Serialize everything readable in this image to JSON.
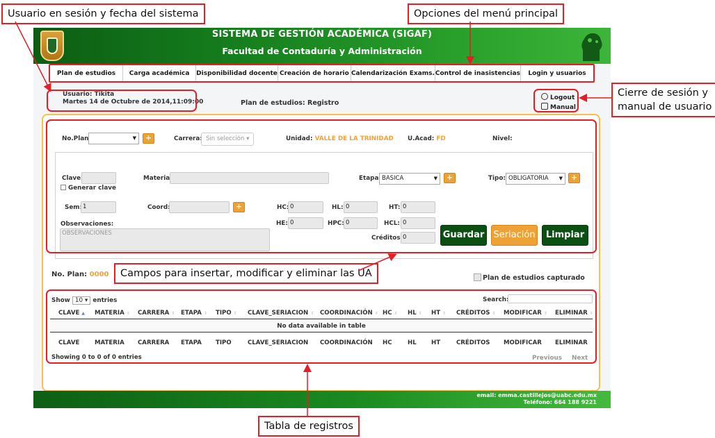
{
  "callouts": {
    "user_date": "Usuario en sesión y fecha del sistema",
    "menu": "Opciones del menú principal",
    "logout_manual": [
      "Cierre de sesión y",
      "manual de usuario"
    ],
    "fields": "Campos para insertar, modificar y eliminar las UA",
    "table": "Tabla de registros"
  },
  "header": {
    "title": "SISTEMA DE GESTIÓN ACADÉMICA (SIGAF)",
    "subtitle": "Facultad de Contaduría y Administración"
  },
  "menu": [
    "Plan de estudios",
    "Carga académica",
    "Disponibilidad docente",
    "Creación de horario",
    "Calendarización Exams.",
    "Control de inasistencias",
    "Login y usuarios"
  ],
  "session": {
    "user": "Usuario: Tikita",
    "date": "Martes 14 de Octubre de 2014,11:09:00",
    "page_title": "Plan de estudios: Registro",
    "logout": "Logout",
    "manual": "Manual"
  },
  "form_top": {
    "no_plan_label": "No.Plan:",
    "carrera_label": "Carrera:",
    "carrera_placeholder": "Sin selección",
    "unidad_label": "Unidad:",
    "unidad_value": "VALLE DE LA TRINIDAD",
    "uacad_label": "U.Acad:",
    "uacad_value": "FD",
    "nivel_label": "Nivel:"
  },
  "form": {
    "clave_label": "Clave:",
    "generar_clave": "Generar clave",
    "materia_label": "Materia:",
    "etapa_label": "Etapa:",
    "etapa_value": "BASICA",
    "tipo_label": "Tipo:",
    "tipo_value": "OBLIGATORIA",
    "sem_label": "Sem:",
    "sem_value": "1",
    "coord_label": "Coord:",
    "hc_label": "HC:",
    "hc_value": "0",
    "hl_label": "HL:",
    "hl_value": "0",
    "ht_label": "HT:",
    "ht_value": "0",
    "he_label": "HE:",
    "he_value": "0",
    "hpc_label": "HPC:",
    "hpc_value": "0",
    "hcl_label": "HCL:",
    "hcl_value": "0",
    "creditos_label": "Créditos:",
    "creditos_value": "0",
    "observaciones_label": "Observaciones:",
    "observaciones_placeholder": "OBSERVACIONES",
    "guardar": "Guardar",
    "seriacion": "Seriación",
    "limpiar": "Limpiar",
    "plus": "+"
  },
  "plan_info": {
    "label": "No. Plan:",
    "value": "0000",
    "captured_label": "Plan de estudios capturado"
  },
  "table": {
    "show": "Show",
    "entries_value": "10",
    "entries": "entries",
    "search_label": "Search:",
    "columns": [
      "CLAVE",
      "MATERIA",
      "CARRERA",
      "ETAPA",
      "TIPO",
      "CLAVE_SERIACION",
      "COORDINACIÓN",
      "HC",
      "HL",
      "HT",
      "CRÉDITOS",
      "MODIFICAR",
      "ELIMINAR"
    ],
    "empty": "No data available in table",
    "info": "Showing 0 to 0 of 0 entries",
    "previous": "Previous",
    "next": "Next"
  },
  "footer": {
    "email": "email: emma.castillejos@uabc.edu.mx",
    "phone": "Teléfono: 664 188 9221"
  },
  "colors": {
    "header_green": "#157e1d",
    "accent_orange": "#eea236",
    "guardar_green": "#0b4f12",
    "callout_red": "#e31e24"
  }
}
